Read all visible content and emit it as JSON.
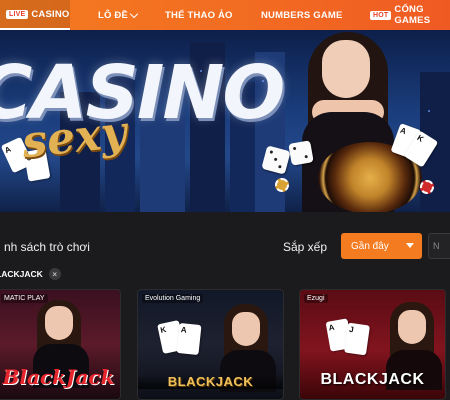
{
  "nav": {
    "items": [
      {
        "tag": "LIVE",
        "label": "CASINO",
        "active": true
      },
      {
        "label": "LÔ ĐỀ",
        "has_dropdown": true
      },
      {
        "label": "THỂ THAO ẢO"
      },
      {
        "label": "NUMBERS GAME"
      },
      {
        "tag": "HOT",
        "label": "CỔNG GAMES"
      }
    ]
  },
  "banner": {
    "title": "CASINO",
    "subtitle": "sexy"
  },
  "list": {
    "section_title": "nh sách trò chơi",
    "sort_label": "Sắp xếp",
    "sort_value": "Gần đây",
    "second_filter_value": "N",
    "active_filter": "BLACKJACK",
    "active_filter_shown": "LACKJACK"
  },
  "games": [
    {
      "provider": "MATIC PLAY",
      "title": "BlackJack"
    },
    {
      "provider": "Evolution Gaming",
      "title": "BLACKJACK"
    },
    {
      "provider": "Ezugi",
      "title": "BLACKJACK"
    }
  ],
  "colors": {
    "accent": "#f47b20",
    "background": "#1b1b1d"
  }
}
